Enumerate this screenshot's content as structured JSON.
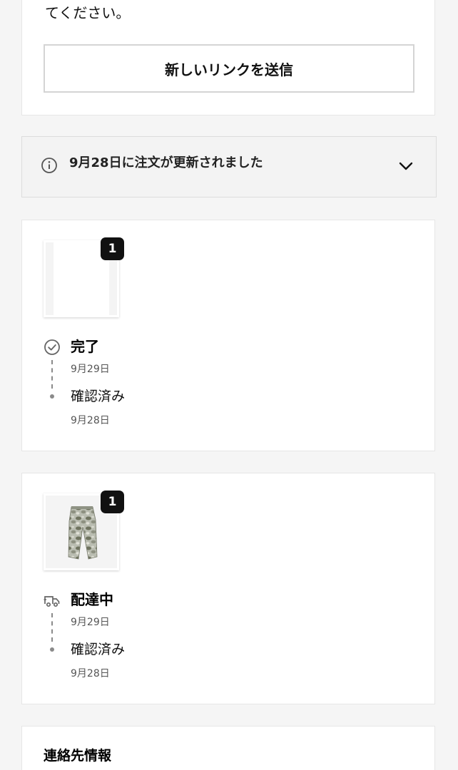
{
  "top_card": {
    "text_tail": "てください。",
    "resend_button_label": "新しいリンクを送信"
  },
  "notice": {
    "text": "9月28日に注文が更新されました",
    "icon": "info-icon",
    "expand_icon": "chevron-down-icon"
  },
  "shipments": [
    {
      "quantity": "1",
      "image": "blank",
      "status_icon": "check-circle-icon",
      "status": "完了",
      "status_date": "9月29日",
      "confirmed_label": "確認済み",
      "confirmed_date": "9月28日"
    },
    {
      "quantity": "1",
      "image": "camo-pants",
      "status_icon": "delivery-truck-icon",
      "status": "配達中",
      "status_date": "9月29日",
      "confirmed_label": "確認済み",
      "confirmed_date": "9月28日"
    }
  ],
  "contact": {
    "title": "連絡先情報"
  },
  "colors": {
    "background": "#f5f5f5",
    "card": "#ffffff",
    "notice_bg": "#f3f3f3",
    "badge": "#111111",
    "muted": "#8a8a8a"
  }
}
